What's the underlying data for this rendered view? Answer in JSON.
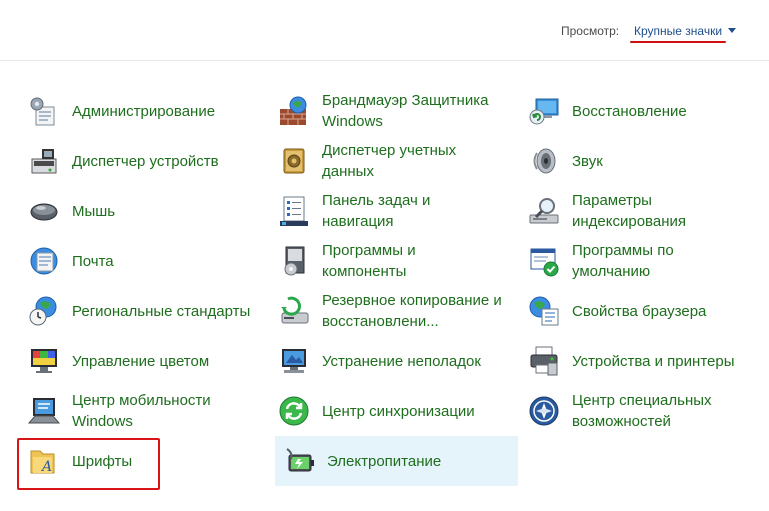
{
  "toolbar": {
    "view_label": "Просмотр:",
    "view_value": "Крупные значки"
  },
  "colors": {
    "link_green": "#1e6e1e",
    "view_blue": "#1e4e8c",
    "annotation_red": "#d81414",
    "hover_bg": "#e5f3fb"
  },
  "items": [
    {
      "label": "Администрирование",
      "icon": "admin-tools-icon"
    },
    {
      "label": "Брандмауэр Защитника\nWindows",
      "icon": "firewall-icon"
    },
    {
      "label": "Восстановление",
      "icon": "recovery-icon"
    },
    {
      "label": "Диспетчер устройств",
      "icon": "device-manager-icon"
    },
    {
      "label": "Диспетчер учетных\nданных",
      "icon": "credential-manager-icon"
    },
    {
      "label": "Звук",
      "icon": "speaker-icon"
    },
    {
      "label": "Мышь",
      "icon": "mouse-icon"
    },
    {
      "label": "Панель задач и\nнавигация",
      "icon": "taskbar-icon"
    },
    {
      "label": "Параметры\nиндексирования",
      "icon": "indexing-icon"
    },
    {
      "label": "Почта",
      "icon": "mail-icon"
    },
    {
      "label": "Программы и\nкомпоненты",
      "icon": "programs-icon"
    },
    {
      "label": "Программы по\nумолчанию",
      "icon": "default-programs-icon"
    },
    {
      "label": "Региональные стандарты",
      "icon": "region-clock-icon"
    },
    {
      "label": "Резервное копирование и\nвосстановлени...",
      "icon": "backup-icon"
    },
    {
      "label": "Свойства браузера",
      "icon": "internet-options-icon"
    },
    {
      "label": "Управление цветом",
      "icon": "color-management-icon"
    },
    {
      "label": "Устранение неполадок",
      "icon": "troubleshooting-icon"
    },
    {
      "label": "Устройства и принтеры",
      "icon": "printer-icon"
    },
    {
      "label": "Центр мобильности\nWindows",
      "icon": "mobility-center-icon"
    },
    {
      "label": "Центр синхронизации",
      "icon": "sync-center-icon"
    },
    {
      "label": "Центр специальных\nвозможностей",
      "icon": "accessibility-icon"
    },
    {
      "label": "Шрифты",
      "icon": "fonts-folder-icon"
    },
    {
      "label": "Электропитание",
      "icon": "power-options-icon"
    }
  ]
}
